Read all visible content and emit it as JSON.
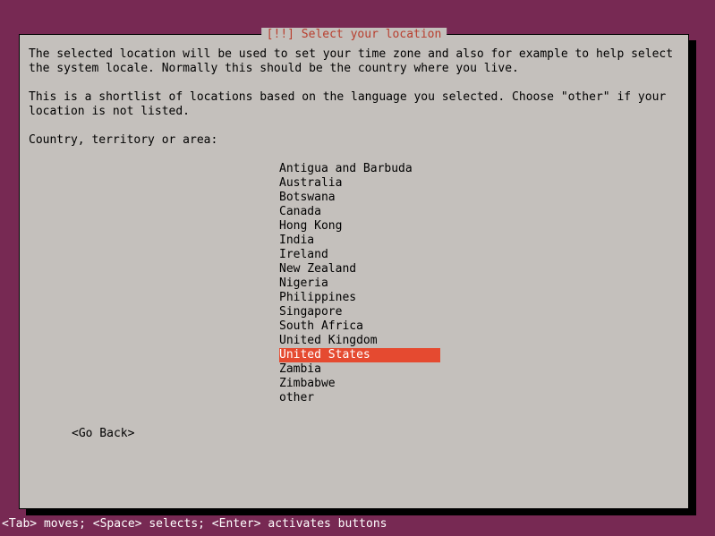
{
  "dialog": {
    "title": "[!!] Select your location",
    "para1": "The selected location will be used to set your time zone and also for example to help select the system locale. Normally this should be the country where you live.",
    "para2": "This is a shortlist of locations based on the language you selected. Choose \"other\" if your location is not listed.",
    "prompt": "Country, territory or area:",
    "locations": [
      "Antigua and Barbuda",
      "Australia",
      "Botswana",
      "Canada",
      "Hong Kong",
      "India",
      "Ireland",
      "New Zealand",
      "Nigeria",
      "Philippines",
      "Singapore",
      "South Africa",
      "United Kingdom",
      "United States",
      "Zambia",
      "Zimbabwe",
      "other"
    ],
    "selected_index": 13,
    "go_back_label": "<Go Back>"
  },
  "helpbar": {
    "text": "<Tab> moves; <Space> selects; <Enter> activates buttons"
  }
}
